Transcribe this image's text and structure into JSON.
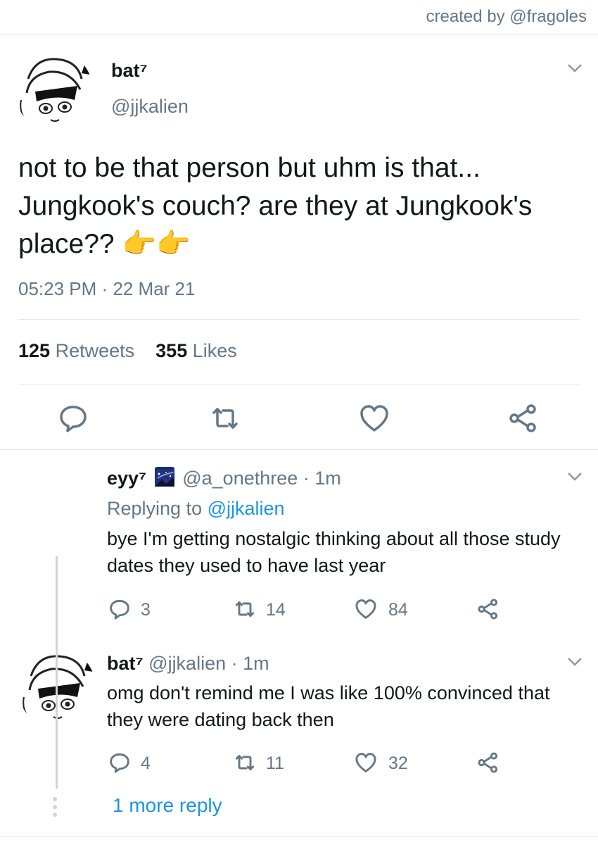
{
  "credit": "created by @fragoles",
  "main_tweet": {
    "name": "bat⁷",
    "handle": "@jjkalien",
    "text": "not to be that person but uhm is that... Jungkook's couch? are they at Jungkook's place?? 👉👉",
    "timestamp": "05:23 PM · 22 Mar 21",
    "retweets_count": "125",
    "retweets_label": "Retweets",
    "likes_count": "355",
    "likes_label": "Likes"
  },
  "replies": [
    {
      "name": "eyy⁷",
      "handle_time": "@a_onethree · 1m",
      "replying_prefix": "Replying to ",
      "replying_to": "@jjkalien",
      "text": "bye I'm getting nostalgic thinking about all those study dates they used to have last year",
      "replies": "3",
      "retweets": "14",
      "likes": "84"
    },
    {
      "name": "bat⁷",
      "handle_time": "@jjkalien · 1m",
      "text": "omg don't remind me I was like 100% convinced that they were dating back then",
      "replies": "4",
      "retweets": "11",
      "likes": "32"
    }
  ],
  "more_replies": "1 more reply",
  "colors": {
    "link": "#1b95e0",
    "muted": "#657786",
    "divider": "#e1e8ed"
  }
}
